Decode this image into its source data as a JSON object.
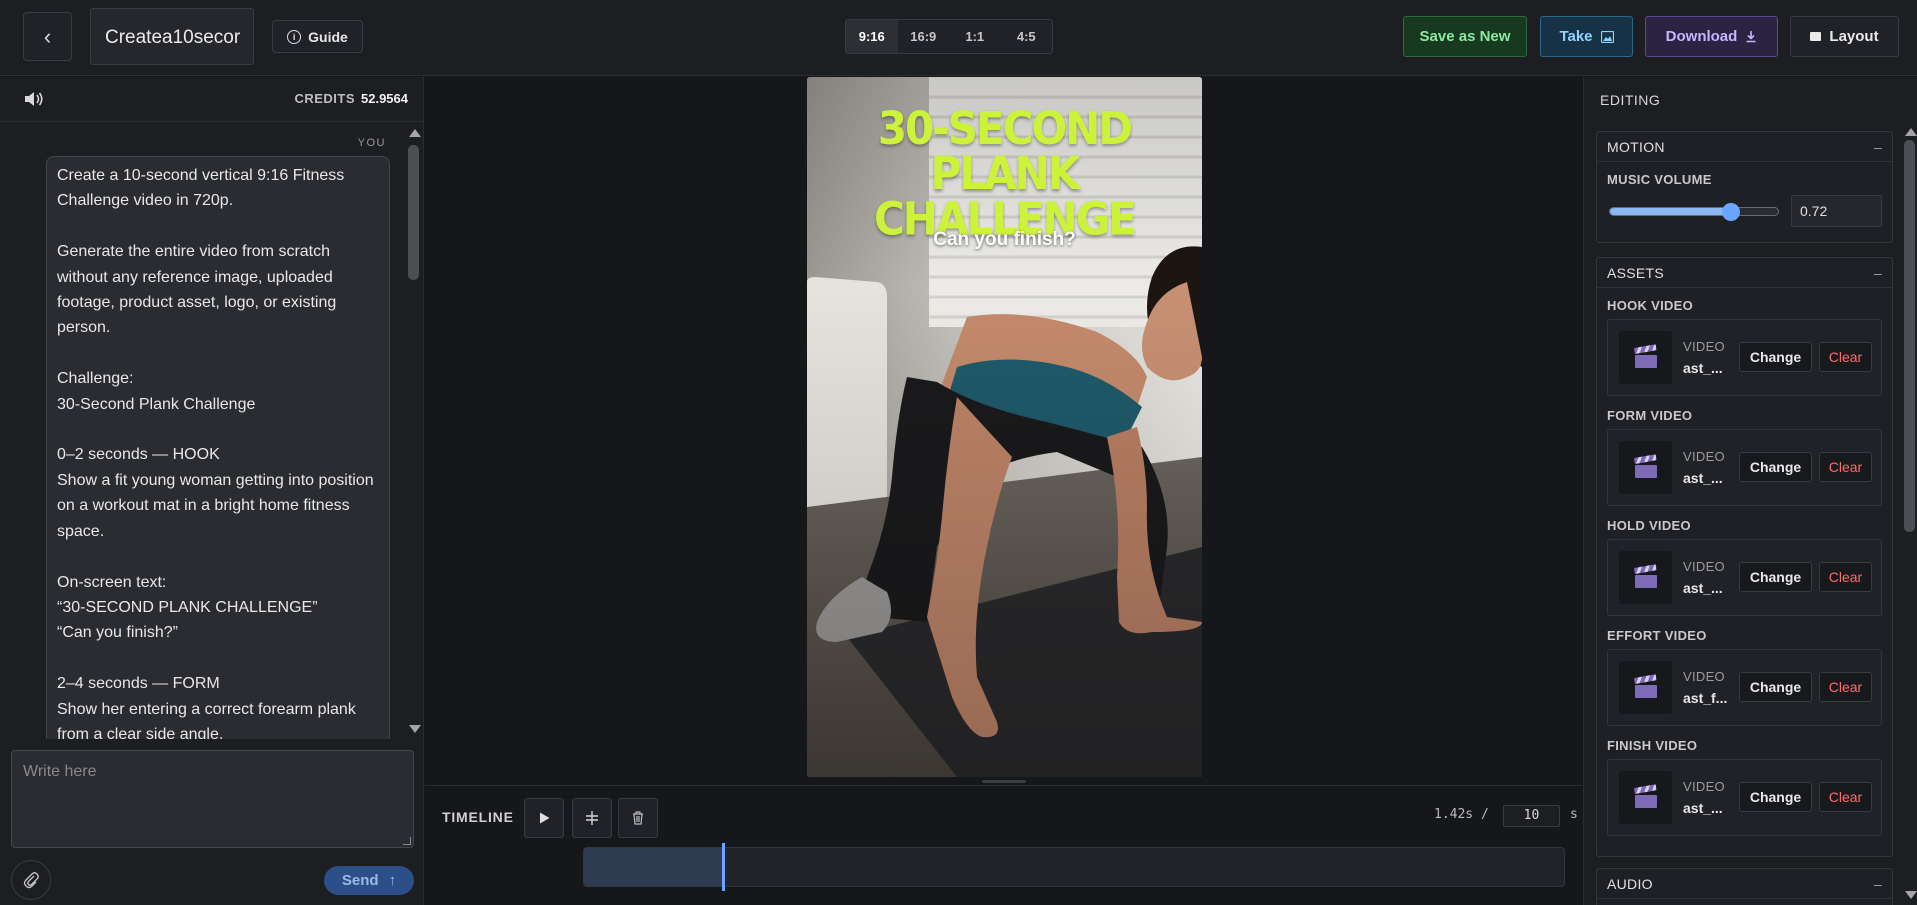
{
  "topbar": {
    "project_title": "Createa10secor",
    "guide_label": "Guide",
    "ratios": [
      "9:16",
      "16:9",
      "1:1",
      "4:5"
    ],
    "active_ratio": "9:16",
    "save_new_label": "Save as New",
    "take_label": "Take",
    "download_label": "Download",
    "layout_label": "Layout"
  },
  "left": {
    "credits_label": "CREDITS",
    "credits_value": "52.9564",
    "you_label": "YOU",
    "message": "Create a 10-second vertical 9:16 Fitness Challenge video in 720p.\n\nGenerate the entire video from scratch without any reference image, uploaded footage, product asset, logo, or existing person.\n\nChallenge:\n30-Second Plank Challenge\n\n0–2 seconds — HOOK\nShow a fit young woman getting into position on a workout mat in a bright home fitness space.\n\nOn-screen text:\n“30-SECOND PLANK CHALLENGE”\n“Can you finish?”\n\n2–4 seconds — FORM\nShow her entering a correct forearm plank from a clear side angle.",
    "input_placeholder": "Write here",
    "send_label": "Send"
  },
  "preview": {
    "title_line1": "30-SECOND PLANK",
    "title_line2": "CHALLENGE",
    "subtitle": "Can you finish?"
  },
  "timeline": {
    "label": "TIMELINE",
    "current_time": "1.42s /",
    "total": "10",
    "unit": "s",
    "progress_fraction": 0.142
  },
  "right": {
    "editing_label": "EDITING",
    "motion": {
      "title": "MOTION",
      "music_volume_label": "MUSIC VOLUME",
      "music_volume": "0.72"
    },
    "assets": {
      "title": "ASSETS",
      "items": [
        {
          "label": "HOOK VIDEO",
          "type": "VIDEO",
          "name": "ast_...",
          "change": "Change",
          "clear": "Clear"
        },
        {
          "label": "FORM VIDEO",
          "type": "VIDEO",
          "name": "ast_...",
          "change": "Change",
          "clear": "Clear"
        },
        {
          "label": "HOLD VIDEO",
          "type": "VIDEO",
          "name": "ast_...",
          "change": "Change",
          "clear": "Clear"
        },
        {
          "label": "EFFORT VIDEO",
          "type": "VIDEO",
          "name": "ast_f...",
          "change": "Change",
          "clear": "Clear"
        },
        {
          "label": "FINISH VIDEO",
          "type": "VIDEO",
          "name": "ast_...",
          "change": "Change",
          "clear": "Clear"
        }
      ]
    },
    "audio": {
      "title": "AUDIO"
    }
  },
  "colors": {
    "accent_blue": "#6aa6ff",
    "title_lime": "#cdf23a",
    "clear_red": "#ff6b6b"
  }
}
